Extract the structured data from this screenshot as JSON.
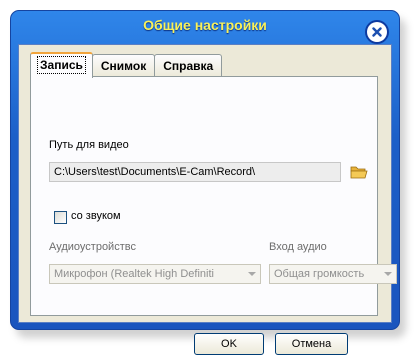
{
  "window": {
    "title": "Общие настройки"
  },
  "tabs": [
    {
      "label": "Запись",
      "active": true
    },
    {
      "label": "Снимок",
      "active": false
    },
    {
      "label": "Справка",
      "active": false
    }
  ],
  "record": {
    "video_path_label": "Путь для видео",
    "video_path_value": "C:\\Users\\test\\Documents\\E-Cam\\Record\\",
    "sound_checkbox_label": "со звуком",
    "sound_checked": false,
    "audio_device_label": "Аудиоустройствс",
    "audio_device_value": "Микрофон (Realtek High Definiti",
    "audio_input_label": "Вход аудио",
    "audio_input_value": "Общая громкость"
  },
  "buttons": {
    "ok": "OK",
    "cancel": "Отмена"
  },
  "icons": {
    "close": "close-icon",
    "folder": "folder-icon",
    "dropdown": "chevron-down-icon"
  },
  "colors": {
    "title": "#f8f15a",
    "titlebar": "#1c5fc8",
    "tab_highlight": "#f1a43b"
  }
}
